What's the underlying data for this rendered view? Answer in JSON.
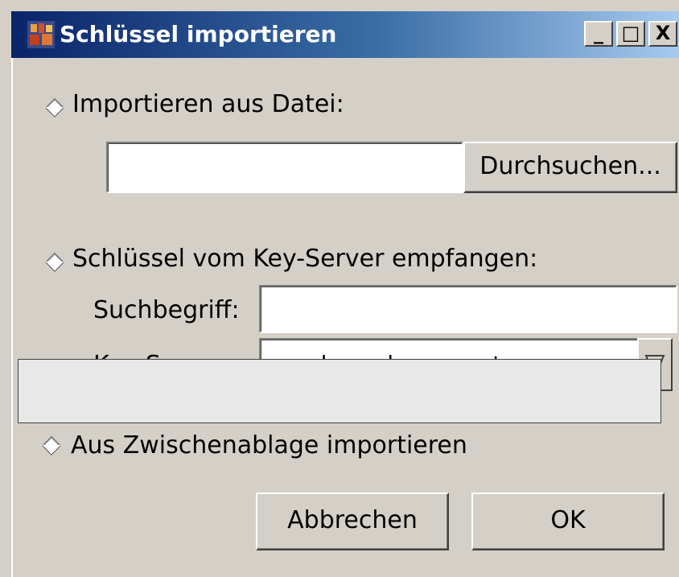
{
  "window": {
    "title": "Schlüssel importieren",
    "icon": "app-icon",
    "controls": {
      "minimize": "_",
      "maximize": "□",
      "close": "X"
    }
  },
  "import_file": {
    "radio_label": "Importieren aus Datei:",
    "path_value": "",
    "browse_button": "Durchsuchen..."
  },
  "keyserver": {
    "radio_label": "Schlüssel vom Key-Server empfangen:",
    "search_label": "Suchbegriff:",
    "search_value": "",
    "server_label": "Key-Server:",
    "server_value": "wwwkeys.de.pgp.net",
    "dropdown_icon": "chevron-down-icon"
  },
  "clipboard": {
    "radio_label": "Aus Zwischenablage importieren"
  },
  "buttons": {
    "cancel": "Abbrechen",
    "ok": "OK"
  },
  "colors": {
    "titlebar_start": "#0a246a",
    "titlebar_end": "#a6caf0",
    "face": "#d4d0c8"
  }
}
